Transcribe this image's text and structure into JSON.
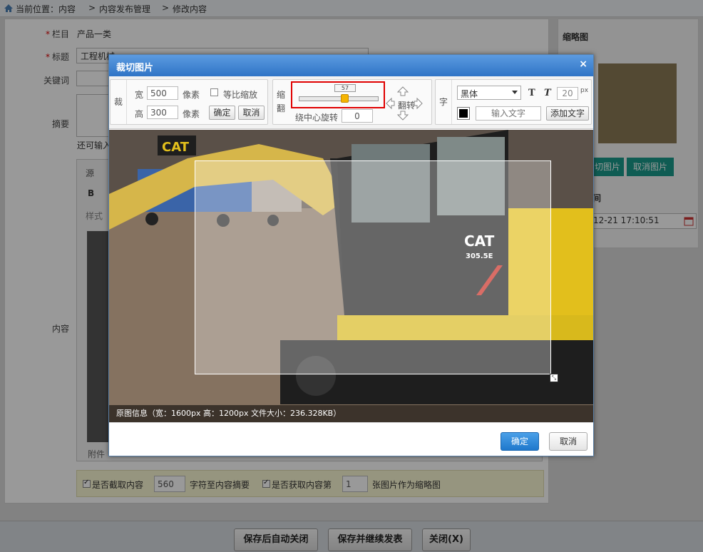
{
  "breadcrumb": {
    "prefix": "当前位置：内容",
    "sep1": ">",
    "crumb2": "内容发布管理",
    "sep2": ">",
    "crumb3": "修改内容"
  },
  "form": {
    "column_label": "栏目",
    "column_value": "产品一类",
    "title_label": "标题",
    "title_value": "工程机械",
    "keyword_label": "关键词",
    "summary_label": "摘要",
    "summary_hint": "还可输入",
    "content_label": "内容",
    "editor_source": "源",
    "bold": "B",
    "style_label": "样式",
    "attach_label": "附件"
  },
  "options_bar": {
    "opt1_label": "是否截取内容",
    "opt1_value": "560",
    "opt1_suffix": "字符至内容摘要",
    "opt2_label": "是否获取内容第",
    "opt2_value": "1",
    "opt2_suffix": "张图片作为缩略图"
  },
  "right_panel": {
    "thumb_title": "缩略图",
    "crop_btn": "切图片",
    "cancel_btn": "取消图片",
    "time_title": "间",
    "time_value": "12-21 17:10:51"
  },
  "bottom": {
    "save_close": "保存后自动关闭",
    "save_continue": "保存并继续发表",
    "close": "关闭(X)"
  },
  "dialog": {
    "title": "裁切图片",
    "close_glyph": "×",
    "crop_group_label": "裁",
    "width_label": "宽",
    "width_value": "500",
    "width_unit": "像素",
    "height_label": "高",
    "height_value": "300",
    "height_unit": "像素",
    "keep_ratio_label": "等比缩放",
    "confirm_label": "确定",
    "cancel_label": "取消",
    "zoom_label_1": "缩",
    "zoom_label_2": "翻",
    "zoom_value": "57",
    "zoom_fraction": 0.57,
    "flip_label": "翻转",
    "rotate_label": "绕中心旋转",
    "rotate_value": "0",
    "text_group_label": "字",
    "font_value": "黑体",
    "bold_icon": "T",
    "italic_icon": "T",
    "font_size_value": "20",
    "font_size_unit": "px",
    "text_placeholder": "输入文字",
    "add_text_label": "添加文字",
    "image_info": "原图信息（宽：1600px  高：1200px  文件大小：236.328KB）",
    "ok_label": "确定",
    "cancel_footer_label": "取消",
    "highlight_color": "#e00000",
    "brand_text": "CAT",
    "model_text": "305.5E"
  }
}
